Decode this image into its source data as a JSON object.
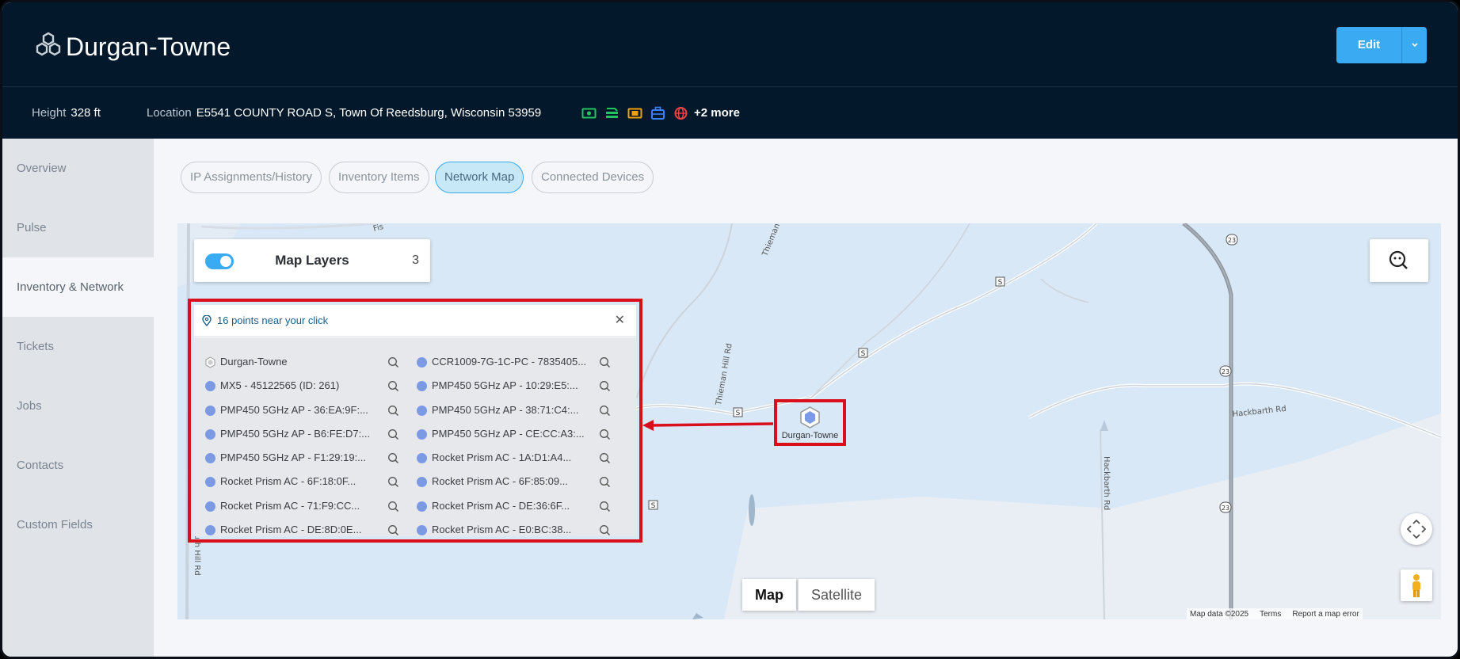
{
  "header": {
    "site_name": "Durgan-Towne",
    "edit_label": "Edit"
  },
  "info": {
    "height_label": "Height",
    "height_value": "328 ft",
    "location_label": "Location",
    "location_value": "E5541 COUNTY ROAD S, Town Of Reedsburg, Wisconsin 53959",
    "more_label": "+2 more",
    "status_icons": [
      {
        "name": "money-icon",
        "color": "#22c55e"
      },
      {
        "name": "equipment-icon",
        "color": "#22c55e"
      },
      {
        "name": "camera-icon",
        "color": "#f59e0b"
      },
      {
        "name": "briefcase-icon",
        "color": "#3b82f6"
      },
      {
        "name": "globe-icon",
        "color": "#ef4444"
      }
    ]
  },
  "sidebar": {
    "items": [
      {
        "label": "Overview"
      },
      {
        "label": "Pulse"
      },
      {
        "label": "Inventory & Network",
        "active": true
      },
      {
        "label": "Tickets"
      },
      {
        "label": "Jobs"
      },
      {
        "label": "Contacts"
      },
      {
        "label": "Custom Fields"
      }
    ]
  },
  "tabs": [
    {
      "label": "IP Assignments/History"
    },
    {
      "label": "Inventory Items"
    },
    {
      "label": "Network Map",
      "active": true
    },
    {
      "label": "Connected Devices"
    }
  ],
  "map": {
    "layers_title": "Map Layers",
    "layers_count": "3",
    "layers_enabled": true,
    "map_type_map": "Map",
    "map_type_satellite": "Satellite",
    "attribution_data": "Map data ©2025",
    "attribution_terms": "Terms",
    "attribution_report": "Report a map error",
    "marker_label": "Durgan-Towne",
    "road_labels": {
      "thieman_hill": "Thieman Hill Rd",
      "thieman_top": "Thieman",
      "hackbarth": "Hackbarth Rd",
      "hackbarth_v": "Hackbarth Rd",
      "route_s": "S",
      "route_23": "23",
      "fish": "Fis",
      "south_hill": "South Hill Rd"
    },
    "popup": {
      "title": "16 points near your click",
      "points_left": [
        {
          "label": "Durgan-Towne",
          "kind": "site"
        },
        {
          "label": "MX5 - 45122565 (ID: 261)",
          "kind": "device"
        },
        {
          "label": "PMP450 5GHz AP - 36:EA:9F:...",
          "kind": "device"
        },
        {
          "label": "PMP450 5GHz AP - B6:FE:D7:...",
          "kind": "device"
        },
        {
          "label": "PMP450 5GHz AP - F1:29:19:...",
          "kind": "device"
        },
        {
          "label": "Rocket Prism AC - 6F:18:0F...",
          "kind": "device"
        },
        {
          "label": "Rocket Prism AC - 71:F9:CC...",
          "kind": "device"
        },
        {
          "label": "Rocket Prism AC - DE:8D:0E...",
          "kind": "device"
        }
      ],
      "points_right": [
        {
          "label": "CCR1009-7G-1C-PC - 7835405...",
          "kind": "device"
        },
        {
          "label": "PMP450 5GHz AP - 10:29:E5:...",
          "kind": "device"
        },
        {
          "label": "PMP450 5GHz AP - 38:71:C4:...",
          "kind": "device"
        },
        {
          "label": "PMP450 5GHz AP - CE:CC:A3:...",
          "kind": "device"
        },
        {
          "label": "Rocket Prism AC - 1A:D1:A4...",
          "kind": "device"
        },
        {
          "label": "Rocket Prism AC - 6F:85:09...",
          "kind": "device"
        },
        {
          "label": "Rocket Prism AC - DE:36:6F...",
          "kind": "device"
        },
        {
          "label": "Rocket Prism AC - E0:BC:38...",
          "kind": "device"
        }
      ]
    }
  },
  "colors": {
    "header_bg": "#03182a",
    "accent": "#3aaaf3",
    "highlight": "#d90f1e",
    "point_dot": "#7b9ae3"
  }
}
